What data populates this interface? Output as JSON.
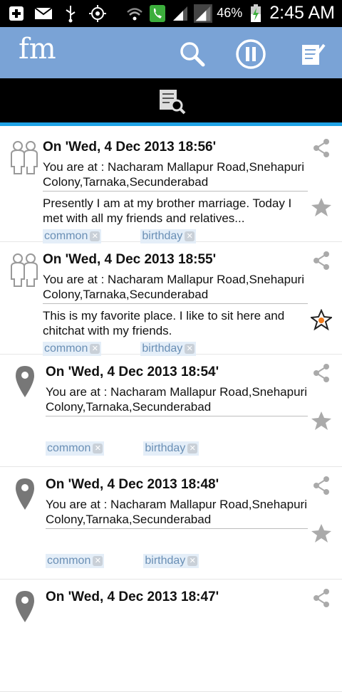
{
  "status_bar": {
    "battery_percent": "46%",
    "time": "2:45 AM",
    "icons": [
      "add-icon",
      "mail-icon",
      "usb-icon",
      "gps-icon",
      "wifi-icon",
      "phone-icon",
      "signal-icon",
      "signal-icon-2",
      "battery-charging-icon"
    ]
  },
  "action_bar": {
    "logo": "fm",
    "icons": [
      "search-icon",
      "pause-icon",
      "notes-icon"
    ]
  },
  "entries": [
    {
      "icon": "people-icon",
      "title": "On 'Wed, 4 Dec 2013 18:56'",
      "location": "You are at : Nacharam Mallapur Road,Snehapuri Colony,Tarnaka,Secunderabad",
      "description": "Presently I am at my brother marriage. Today I met with all my friends and relatives...",
      "tags": [
        "common",
        "birthday"
      ],
      "starred": false
    },
    {
      "icon": "people-icon",
      "title": "On 'Wed, 4 Dec 2013 18:55'",
      "location": "You are at : Nacharam Mallapur Road,Snehapuri Colony,Tarnaka,Secunderabad",
      "description": "This is my favorite place. I like to sit here and chitchat with my friends.",
      "tags": [
        "common",
        "birthday"
      ],
      "starred": true
    },
    {
      "icon": "map-pin-icon",
      "title": "On 'Wed, 4 Dec 2013 18:54'",
      "location": "You are at : Nacharam Mallapur Road,Snehapuri Colony,Tarnaka,Secunderabad",
      "description": "",
      "tags": [
        "common",
        "birthday"
      ],
      "starred": false
    },
    {
      "icon": "map-pin-icon",
      "title": "On 'Wed, 4 Dec 2013 18:48'",
      "location": "You are at : Nacharam Mallapur Road,Snehapuri Colony,Tarnaka,Secunderabad",
      "description": "",
      "tags": [
        "common",
        "birthday"
      ],
      "starred": false
    },
    {
      "icon": "map-pin-icon",
      "title": "On 'Wed, 4 Dec 2013 18:47'",
      "location": "",
      "description": "",
      "tags": [],
      "starred": false
    }
  ]
}
